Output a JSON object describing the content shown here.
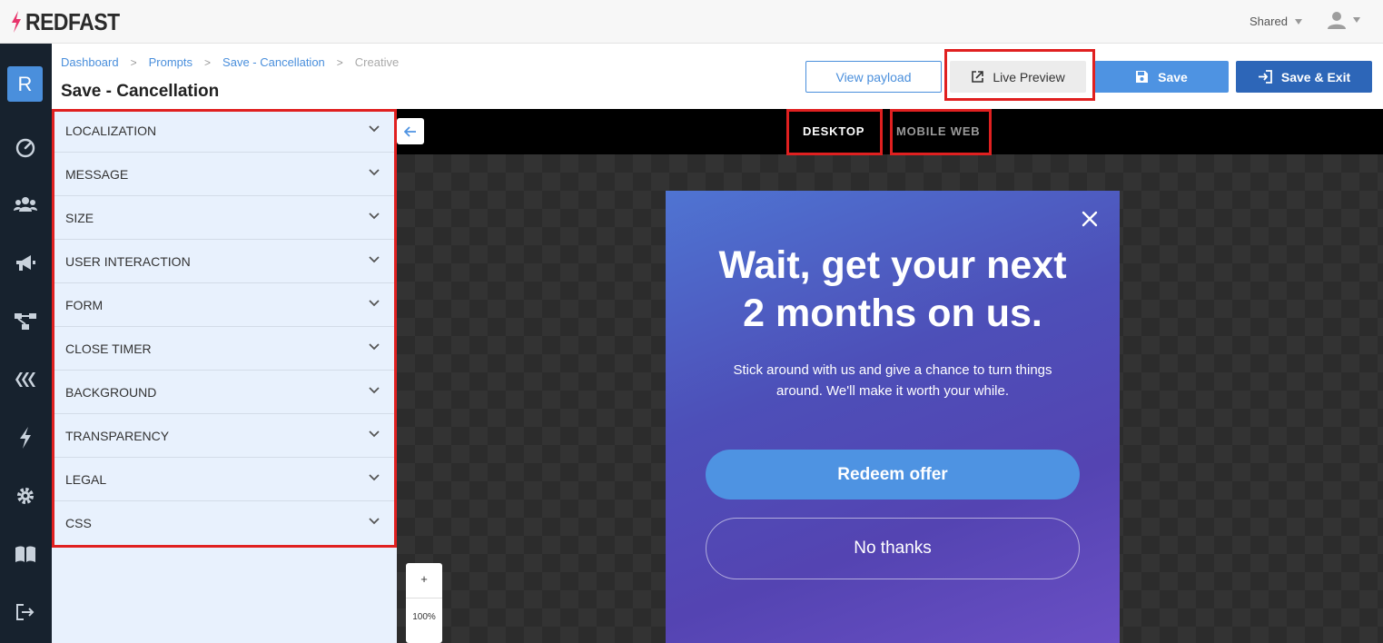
{
  "brand": {
    "name": "REDFAST",
    "accent": "#e8336b"
  },
  "topbar": {
    "workspace": "Shared"
  },
  "nav": {
    "initial": "R"
  },
  "breadcrumb": {
    "items": [
      "Dashboard",
      "Prompts",
      "Save - Cancellation"
    ],
    "current": "Creative"
  },
  "page": {
    "title": "Save - Cancellation"
  },
  "toolbar": {
    "view_payload": "View payload",
    "live_preview": "Live Preview",
    "save": "Save",
    "save_exit": "Save & Exit"
  },
  "sections": [
    {
      "label": "LOCALIZATION"
    },
    {
      "label": "MESSAGE"
    },
    {
      "label": "SIZE"
    },
    {
      "label": "USER INTERACTION"
    },
    {
      "label": "FORM"
    },
    {
      "label": "CLOSE TIMER"
    },
    {
      "label": "BACKGROUND"
    },
    {
      "label": "TRANSPARENCY"
    },
    {
      "label": "LEGAL"
    },
    {
      "label": "CSS"
    }
  ],
  "preview": {
    "tabs": {
      "desktop": "DESKTOP",
      "mobile": "MOBILE WEB"
    },
    "zoom": {
      "plus": "+",
      "level": "100%"
    },
    "prompt": {
      "title_line1": "Wait, get your next",
      "title_line2": "2 months on us.",
      "body_line1": "Stick around with us and give a chance to turn things",
      "body_line2": "around. We'll make it worth your while.",
      "cta": "Redeem offer",
      "decline": "No thanks"
    }
  },
  "colors": {
    "primary": "#4e93e2",
    "dark_primary": "#2d66b8",
    "nav_bg": "#17222e",
    "highlight": "#e02020"
  }
}
